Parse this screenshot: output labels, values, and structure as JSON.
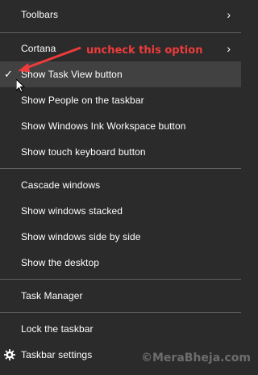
{
  "menu": {
    "items": [
      {
        "label": "Toolbars",
        "submenu": true
      },
      {
        "label": "Cortana",
        "submenu": true
      },
      {
        "label": "Show Task View button",
        "checked": true,
        "highlighted": true
      },
      {
        "label": "Show People on the taskbar"
      },
      {
        "label": "Show Windows Ink Workspace button"
      },
      {
        "label": "Show touch keyboard button"
      },
      {
        "label": "Cascade windows"
      },
      {
        "label": "Show windows stacked"
      },
      {
        "label": "Show windows side by side"
      },
      {
        "label": "Show the desktop"
      },
      {
        "label": "Task Manager"
      },
      {
        "label": "Lock the taskbar"
      },
      {
        "label": "Taskbar settings",
        "icon": "gear-icon"
      }
    ],
    "chevron_glyph": "›",
    "check_glyph": "✓"
  },
  "annotation": {
    "text": "uncheck this option",
    "color": "#ef3b3b"
  },
  "watermark": {
    "text": "©MeraBheja.com"
  },
  "colors": {
    "background": "#2b2b2b",
    "highlight": "#414141",
    "separator": "#606060"
  }
}
